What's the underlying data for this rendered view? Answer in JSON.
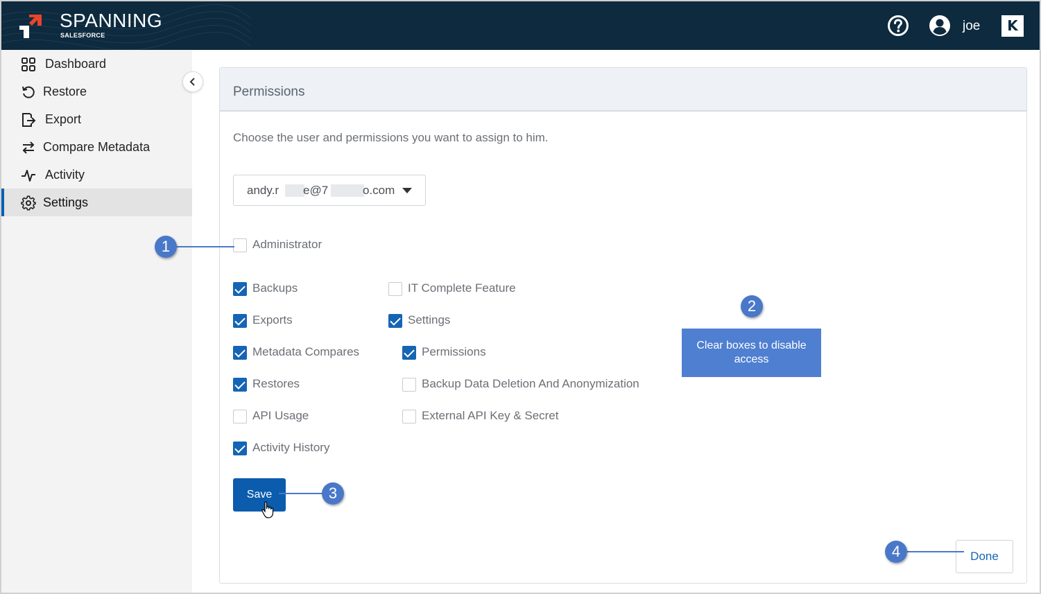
{
  "header": {
    "brand": "SPANNING",
    "brand_sub": "SALESFORCE",
    "user_name": "joe",
    "help_icon": "help-circle-icon",
    "user_icon": "user-avatar-icon",
    "partner_logo": "K"
  },
  "sidebar": {
    "items": [
      {
        "label": "Dashboard",
        "icon": "grid-icon"
      },
      {
        "label": "Restore",
        "icon": "restore-icon"
      },
      {
        "label": "Export",
        "icon": "export-icon"
      },
      {
        "label": "Compare Metadata",
        "icon": "swap-arrows-icon"
      },
      {
        "label": "Activity",
        "icon": "activity-pulse-icon"
      },
      {
        "label": "Settings",
        "icon": "gear-icon"
      }
    ],
    "active": "Settings"
  },
  "panel": {
    "title": "Permissions",
    "intro": "Choose the user and permissions you want to assign to him.",
    "user_select": {
      "prefix": "andy.r",
      "middle": "e@7",
      "suffix": "o.com"
    },
    "administrator": {
      "label": "Administrator",
      "checked": false
    },
    "permissions_left": [
      {
        "label": "Backups",
        "checked": true
      },
      {
        "label": "Exports",
        "checked": true
      },
      {
        "label": "Metadata Compares",
        "checked": true
      },
      {
        "label": "Restores",
        "checked": true
      },
      {
        "label": "API Usage",
        "checked": false
      },
      {
        "label": "Activity History",
        "checked": true
      }
    ],
    "permissions_right": [
      {
        "label": "IT Complete Feature",
        "checked": false
      },
      {
        "label": "Settings",
        "checked": true
      },
      {
        "label": "Permissions",
        "checked": true
      },
      {
        "label": "Backup Data Deletion And Anonymization",
        "checked": false
      },
      {
        "label": "External API Key & Secret",
        "checked": false
      }
    ],
    "save_label": "Save",
    "done_label": "Done"
  },
  "annotations": {
    "step1": "1",
    "step2": "2",
    "step3": "3",
    "step4": "4",
    "tip": "Clear boxes to disable access",
    "color": "#4a78c9"
  },
  "colors": {
    "header_bg": "#0d2a3e",
    "accent": "#1565b4",
    "sidebar_bg": "#f3f3f3",
    "logo_red": "#e8452c"
  }
}
